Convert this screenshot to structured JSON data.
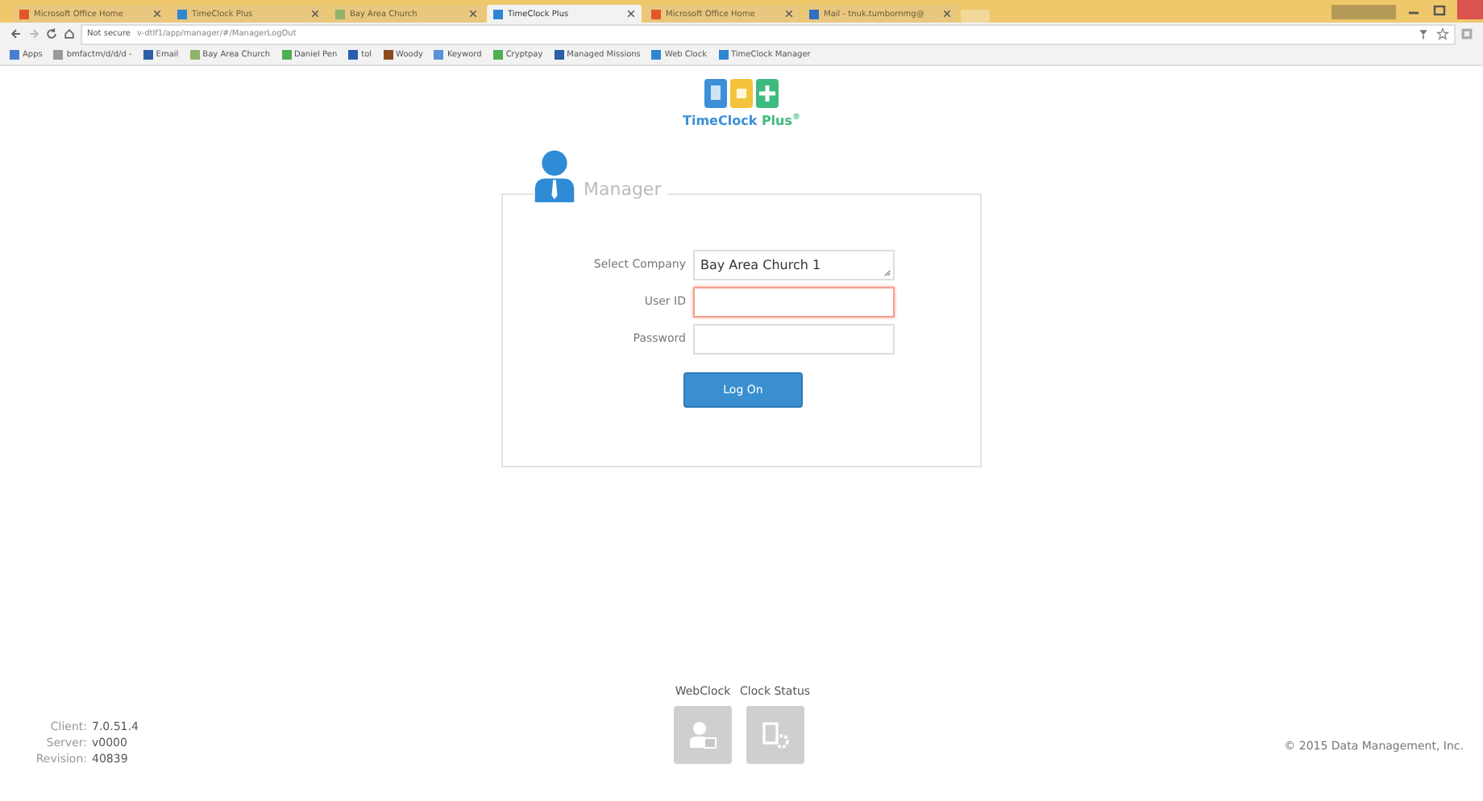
{
  "browser": {
    "tabs": [
      {
        "title": "Microsoft Office Home",
        "color": "#e2572a",
        "selected": false
      },
      {
        "title": "TimeClock Plus",
        "color": "#2f86d0",
        "selected": false
      },
      {
        "title": "Bay Area Church",
        "color": "#8fb36a",
        "selected": false
      },
      {
        "title": "TimeClock Plus",
        "color": "#2f86d0",
        "selected": true
      },
      {
        "title": "Microsoft Office Home",
        "color": "#e2572a",
        "selected": false
      },
      {
        "title": "Mail - tnuk.tumbornmg@",
        "color": "#2f6fc0",
        "selected": false
      }
    ],
    "security": "Not secure",
    "url": "v-dtlf1/app/manager/#/ManagerLogOut",
    "bookmarks": [
      {
        "label": "Apps",
        "color": "#4a7fd0"
      },
      {
        "label": "bmfactm/d/d/d -",
        "color": "#999999"
      },
      {
        "label": "Email",
        "color": "#2b5fa8"
      },
      {
        "label": "Bay Area Church",
        "color": "#8fb36a"
      },
      {
        "label": "Daniel Pen",
        "color": "#4caf50"
      },
      {
        "label": "tol",
        "color": "#2a5db0"
      },
      {
        "label": "Woody",
        "color": "#8a4b1f"
      },
      {
        "label": "Keyword",
        "color": "#5b8fd6"
      },
      {
        "label": "Cryptpay",
        "color": "#4caf50"
      },
      {
        "label": "Managed Missions",
        "color": "#2b5fa8"
      },
      {
        "label": "Web Clock",
        "color": "#2f86d0"
      },
      {
        "label": "TimeClock Manager",
        "color": "#2f86d0"
      }
    ]
  },
  "logo": {
    "name": "TimeClock",
    "plus": "Plus",
    "mark": "®"
  },
  "login": {
    "title": "Manager",
    "fields": [
      {
        "label": "Select Company",
        "kind": "select",
        "value": "Bay Area Church  1",
        "error": false
      },
      {
        "label": "User ID",
        "kind": "text",
        "error": true
      },
      {
        "label": "Password",
        "kind": "password",
        "error": false
      }
    ],
    "button": "Log On"
  },
  "version": [
    {
      "label": "Client:",
      "value": "7.0.51.4"
    },
    {
      "label": "Server:",
      "value": "v0000"
    },
    {
      "label": "Revision:",
      "value": "40839"
    }
  ],
  "links": [
    {
      "label": "WebClock",
      "kind": "webclock"
    },
    {
      "label": "Clock Status",
      "kind": "status"
    }
  ],
  "copyright": "© 2015 Data Management, Inc."
}
